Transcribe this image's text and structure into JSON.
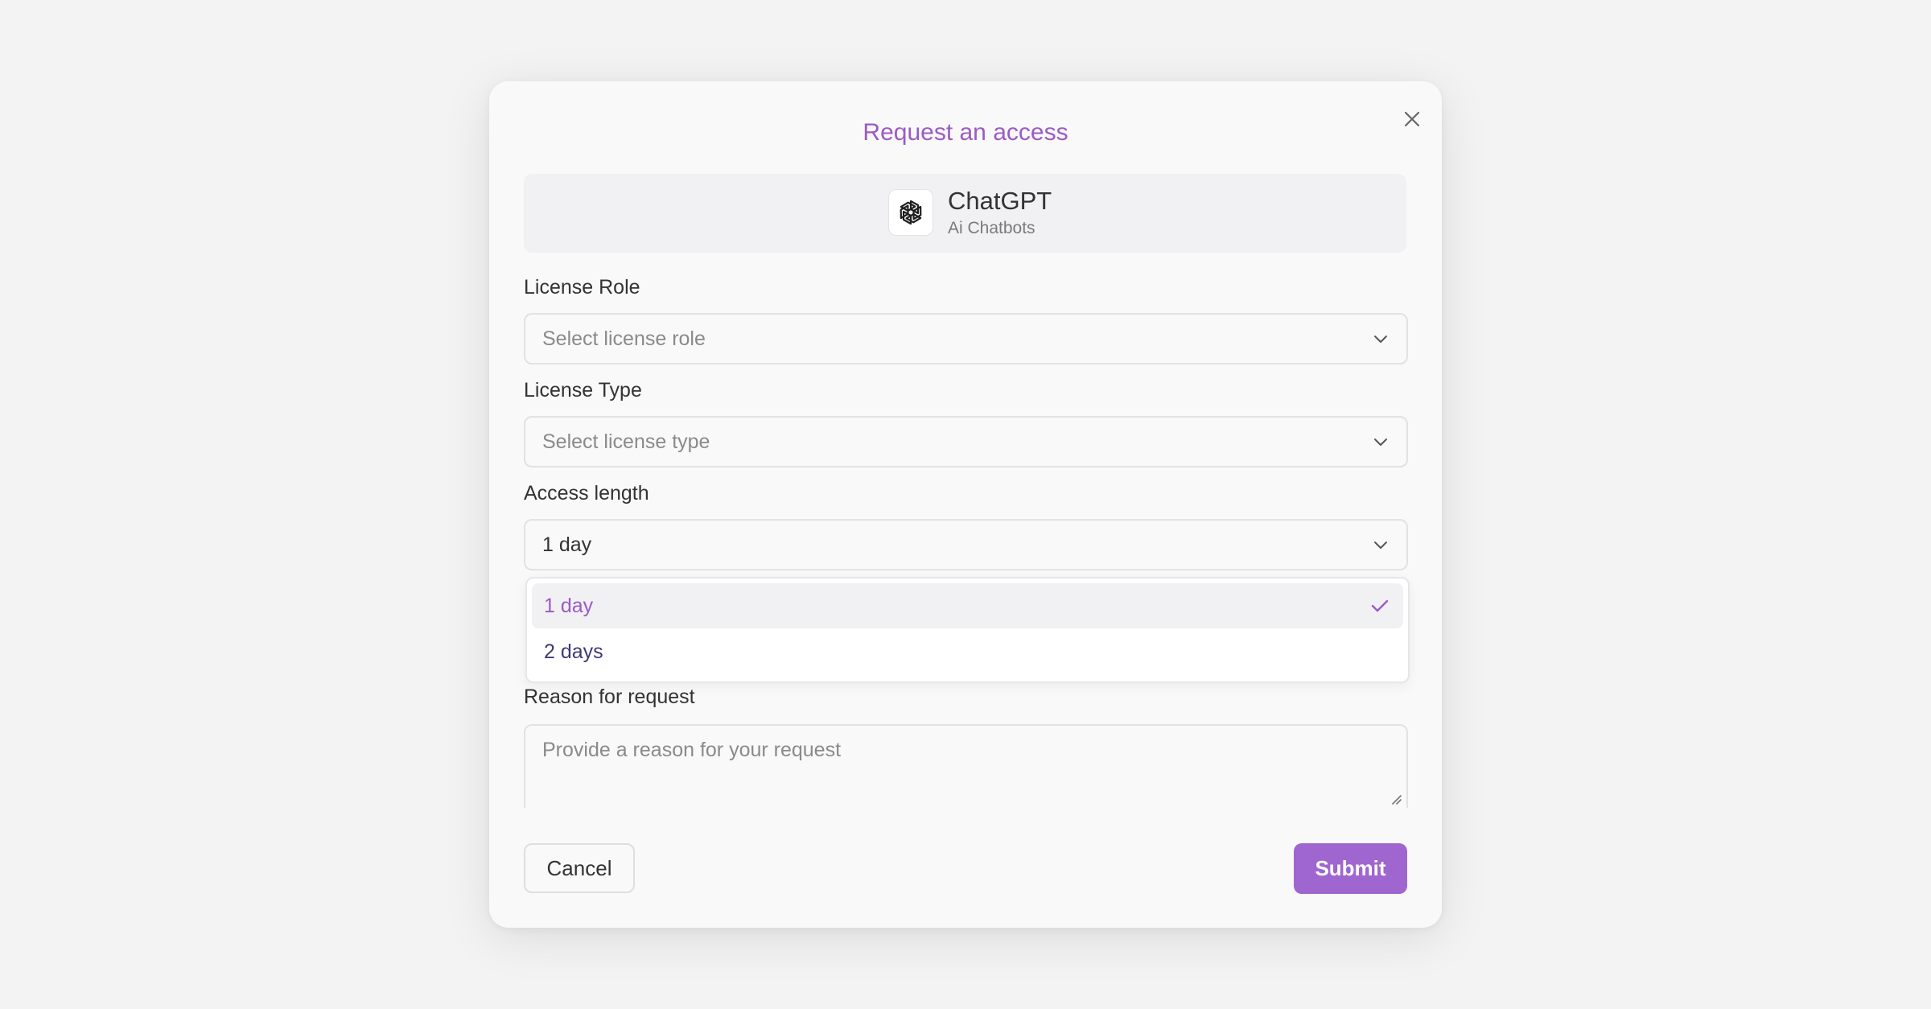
{
  "modal": {
    "title": "Request an access"
  },
  "app": {
    "name": "ChatGPT",
    "category": "Ai Chatbots",
    "icon": "openai-logo-icon"
  },
  "license_role": {
    "label": "License Role",
    "placeholder": "Select license role"
  },
  "license_type": {
    "label": "License Type",
    "placeholder": "Select license type"
  },
  "access_length": {
    "label": "Access length",
    "value": "1 day",
    "options": [
      {
        "label": "1 day",
        "selected": true
      },
      {
        "label": "2 days",
        "selected": false
      }
    ]
  },
  "reason": {
    "label": "Reason for request",
    "placeholder": "Provide a reason for your request"
  },
  "actions": {
    "cancel_label": "Cancel",
    "submit_label": "Submit"
  },
  "colors": {
    "accent": "#9b5bc4",
    "button": "#a066cf",
    "background": "#f3f3f3",
    "modal": "#f9f9f9"
  }
}
